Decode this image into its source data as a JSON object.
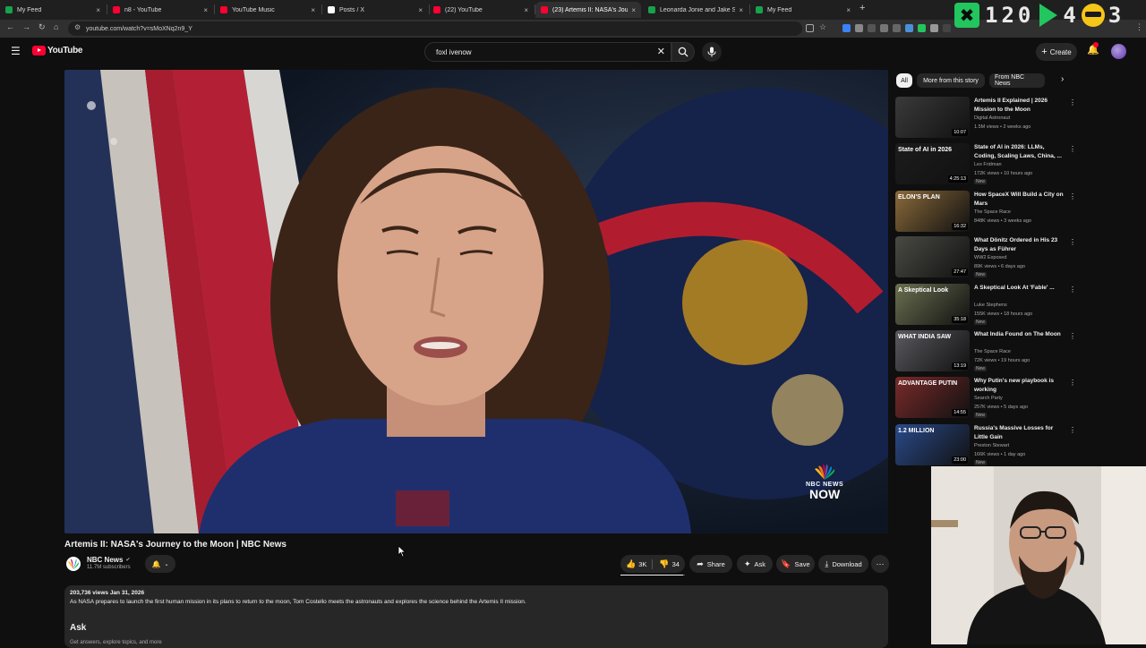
{
  "browser": {
    "tabs": [
      {
        "label": "My Feed",
        "color": "#16a34a"
      },
      {
        "label": "n8 - YouTube",
        "color": "#ff0033"
      },
      {
        "label": "YouTube Music",
        "color": "#ff0033"
      },
      {
        "label": "Posts / X",
        "color": "#ffffff"
      },
      {
        "label": "(22) YouTube",
        "color": "#ff0033"
      },
      {
        "label": "(23) Artemis II: NASA's Jou",
        "color": "#ff0033",
        "active": true
      },
      {
        "label": "Leonarda Jonie and Jake Shiel",
        "color": "#16a34a"
      },
      {
        "label": "My Feed",
        "color": "#16a34a"
      }
    ],
    "url": "youtube.com/watch?v=sMoXNq2n9_Y"
  },
  "hud": {
    "value1": "120",
    "value2": "4",
    "value3": "3"
  },
  "youtube": {
    "logo_text": "YouTube",
    "search_value": "foxl ivenow",
    "create_label": "Create"
  },
  "video": {
    "title": "Artemis II: NASA's Journey to the Moon | NBC News",
    "watermark_line1": "NBC NEWS",
    "watermark_line2": "NOW",
    "channel": "NBC News",
    "subscribers": "11.7M subscribers",
    "likes": "3K",
    "dislikes": "34",
    "share_label": "Share",
    "ask_label": "Ask",
    "save_label": "Save",
    "download_label": "Download",
    "description_meta": "203,736 views  Jan 31, 2026",
    "description_text": "As NASA prepares to launch the first human mission in its plans to return to the moon, Tom Costello meets the astronauts and explores the science behind the Artemis II mission.",
    "ask_section_title": "Ask",
    "ask_section_hint": "Get answers, explore topics, and more"
  },
  "sidebar": {
    "chips": [
      "All",
      "More from this story",
      "From NBC News"
    ],
    "recommendations": [
      {
        "title": "Artemis II Explained | 2026 Mission to the Moon",
        "channel": "Digital Astronaut",
        "meta": "1.5M views • 2 weeks ago",
        "duration": "10:07",
        "is_new": false,
        "thumb": "#3a3a3a",
        "thumb_text": ""
      },
      {
        "title": "State of AI in 2026: LLMs, Coding, Scaling Laws, China, ...",
        "channel": "Lex Fridman",
        "meta": "172K views • 10 hours ago",
        "duration": "4:25:13",
        "is_new": true,
        "thumb": "#1c1c1c",
        "thumb_text": "State of AI in 2026"
      },
      {
        "title": "How SpaceX Will Build a City on Mars",
        "channel": "The Space Race",
        "meta": "848K views • 3 weeks ago",
        "duration": "16:32",
        "is_new": false,
        "thumb": "#8a6a3a",
        "thumb_text": "ELON'S PLAN"
      },
      {
        "title": "What Dönitz Ordered in His 23 Days as Führer",
        "channel": "WW2 Exposed",
        "meta": "89K views • 6 days ago",
        "duration": "27:47",
        "is_new": true,
        "thumb": "#4a4a44",
        "thumb_text": ""
      },
      {
        "title": "A Skeptical Look At 'Fable' ...",
        "channel": "Luke Stephens",
        "meta": "155K views • 18 hours ago",
        "duration": "35:18",
        "is_new": true,
        "thumb": "#6a7050",
        "thumb_text": "A Skeptical Look"
      },
      {
        "title": "What India Found on The Moon",
        "channel": "The Space Race",
        "meta": "72K views • 19 hours ago",
        "duration": "13:19",
        "is_new": true,
        "thumb": "#5a5a60",
        "thumb_text": "WHAT INDIA SAW"
      },
      {
        "title": "Why Putin's new playbook is working",
        "channel": "Search Party",
        "meta": "257K views • 5 days ago",
        "duration": "14:55",
        "is_new": true,
        "thumb": "#7a2a2a",
        "thumb_text": "ADVANTAGE PUTIN"
      },
      {
        "title": "Russia's Massive Losses for Little Gain",
        "channel": "Preston Stewart",
        "meta": "166K views • 1 day ago",
        "duration": "23:00",
        "is_new": true,
        "thumb": "#2a4a8a",
        "thumb_text": "1.2 MILLION"
      }
    ]
  },
  "colors": {
    "brand_red": "#ff0033",
    "background": "#0f0f0f",
    "surface": "#272727"
  }
}
